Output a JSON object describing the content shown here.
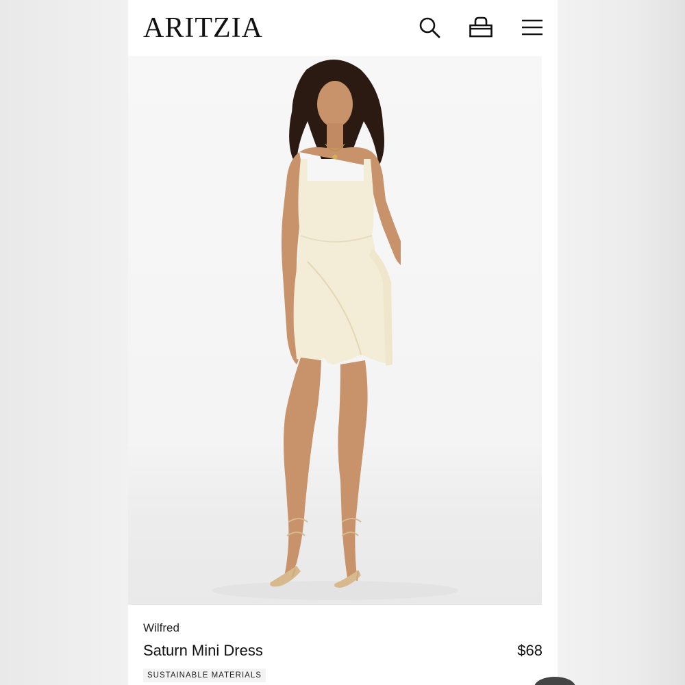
{
  "header": {
    "logo": "ARITZIA",
    "icons": [
      "search-icon",
      "bag-icon",
      "menu-icon"
    ]
  },
  "product": {
    "brand": "Wilfred",
    "name": "Saturn Mini Dress",
    "price": "$68",
    "tag": "SUSTAINABLE MATERIALS"
  },
  "colors": {
    "dress": "#f3ecd6",
    "skin": "#c8926a",
    "hair": "#2a1a12",
    "background": "#f5f5f5"
  }
}
